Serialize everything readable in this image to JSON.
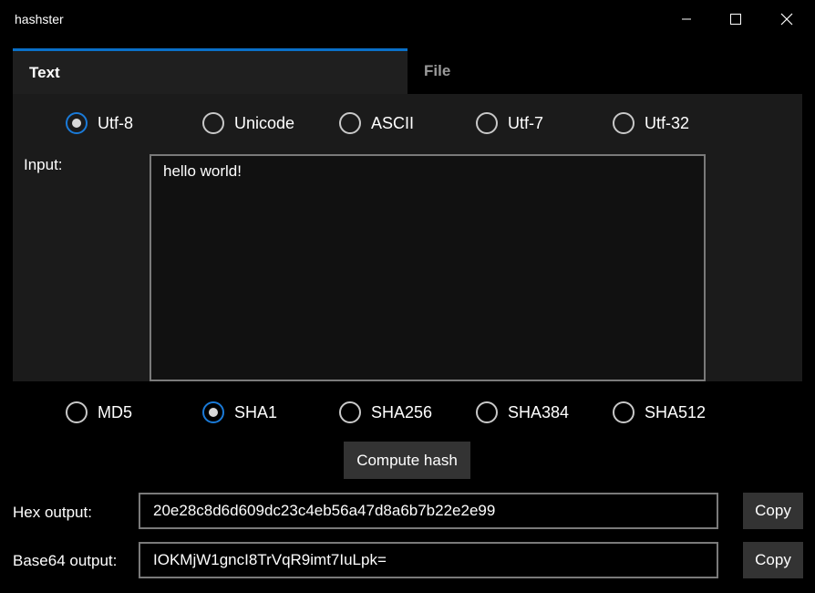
{
  "window": {
    "title": "hashster"
  },
  "tabs": [
    {
      "label": "Text"
    },
    {
      "label": "File"
    }
  ],
  "encodings": [
    {
      "label": "Utf-8",
      "checked": true
    },
    {
      "label": "Unicode",
      "checked": false
    },
    {
      "label": "ASCII",
      "checked": false
    },
    {
      "label": "Utf-7",
      "checked": false
    },
    {
      "label": "Utf-32",
      "checked": false
    }
  ],
  "input": {
    "label": "Input:",
    "value": "hello world!"
  },
  "algorithms": [
    {
      "label": "MD5",
      "checked": false
    },
    {
      "label": "SHA1",
      "checked": true
    },
    {
      "label": "SHA256",
      "checked": false
    },
    {
      "label": "SHA384",
      "checked": false
    },
    {
      "label": "SHA512",
      "checked": false
    }
  ],
  "compute_button": "Compute hash",
  "hex_output": {
    "label": "Hex output:",
    "value": "20e28c8d6d609dc23c4eb56a47d8a6b7b22e2e99",
    "copy_label": "Copy"
  },
  "base64_output": {
    "label": "Base64 output:",
    "value": "IOKMjW1gncI8TrVqR9imt7IuLpk=",
    "copy_label": "Copy"
  },
  "colors": {
    "accent": "#0a70c8",
    "background": "#000000",
    "panel": "#1b1b1b"
  }
}
